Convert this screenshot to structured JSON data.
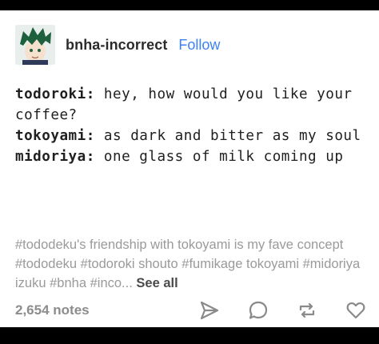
{
  "post": {
    "blog_name": "bnha-incorrect",
    "follow_label": "Follow",
    "avatar_icon": "anime-avatar-icon",
    "dialogue": [
      {
        "speaker": "todoroki:",
        "text": " hey, how would you like your coffee?"
      },
      {
        "speaker": "tokoyami:",
        "text": " as dark and bitter as my soul"
      },
      {
        "speaker": "midoriya:",
        "text": " one glass of milk coming up"
      }
    ],
    "tags": [
      "#tododeku's friendship with tokoyami is my fave concept",
      "#tododeku",
      "#todoroki shouto",
      "#fumikage tokoyami",
      "#midoriya izuku",
      "#bnha",
      "#inco..."
    ],
    "see_all_label": "See all",
    "notes": "2,654 notes",
    "actions": [
      "share-icon",
      "reply-icon",
      "reblog-icon",
      "like-icon"
    ]
  },
  "colors": {
    "background": "#000000",
    "card": "#ffffff",
    "follow": "#3b82f6",
    "tags": "#9a9a9a",
    "notes": "#8c8c8c"
  }
}
